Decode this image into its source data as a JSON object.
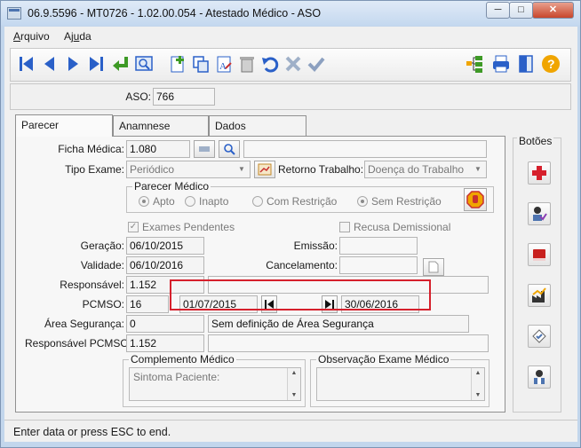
{
  "window": {
    "title": "06.9.5596 - MT0726 - 1.02.00.054 - Atestado Médico - ASO",
    "min_glyph": "─",
    "max_glyph": "□",
    "close_glyph": "✕"
  },
  "menu": [
    {
      "accel": "A",
      "rest": "rquivo"
    },
    {
      "pre": "Aj",
      "accel": "u",
      "rest": "da"
    }
  ],
  "toolbar_icons": [
    "first-record-icon",
    "previous-record-icon",
    "next-record-icon",
    "last-record-icon",
    "return-icon",
    "zoom-icon",
    "new-record-icon",
    "copy-icon",
    "edit-icon",
    "delete-icon",
    "undo-icon",
    "cancel-icon",
    "confirm-icon",
    "hierarchy-icon",
    "print-icon",
    "exit-icon",
    "help-icon"
  ],
  "aso": {
    "label": "ASO:",
    "value": "766"
  },
  "tabs": [
    "Parecer",
    "Anamnese",
    "Dados"
  ],
  "form": {
    "ficha_medica_label": "Ficha Médica:",
    "ficha_medica_value": "1.080",
    "tipo_exame_label": "Tipo Exame:",
    "tipo_exame_value": "Periódico",
    "retorno_label": "Retorno Trabalho:",
    "retorno_value": "Doença do Trabalho",
    "parecer_group_title": "Parecer Médico",
    "parecer_options": [
      "Apto",
      "Inapto",
      "Com Restrição",
      "Sem Restrição"
    ],
    "exames_pendentes": "Exames Pendentes",
    "recusa_demissional": "Recusa Demissional",
    "geracao_label": "Geração:",
    "geracao_value": "06/10/2015",
    "emissao_label": "Emissão:",
    "validade_label": "Validade:",
    "validade_value": "06/10/2016",
    "cancelamento_label": "Cancelamento:",
    "responsavel_label": "Responsável:",
    "responsavel_value": "1.152",
    "pcmso_label": "PCMSO:",
    "pcmso_value": "16",
    "pcmso_start": "01/07/2015",
    "pcmso_end": "30/06/2016",
    "area_label": "Área Segurança:",
    "area_value": "0",
    "area_desc": "Sem definição de Área Segurança",
    "resp_pcmso_label": "Responsável PCMSO:",
    "resp_pcmso_value": "1.152",
    "complemento_title": "Complemento Médico",
    "complemento_value": "Sintoma Paciente:",
    "observacao_title": "Observação Exame Médico"
  },
  "side": {
    "title": "Botões",
    "buttons": [
      "add-red-cross-icon",
      "doctor-check-icon",
      "medical-book-icon",
      "factory-chart-icon",
      "document-check-icon",
      "doctor-icon"
    ]
  },
  "status": "Enter data or press ESC to end.",
  "colors": {
    "accent_blue": "#2a60c8",
    "highlight_red": "#d6202c",
    "green_return": "#3e9a26",
    "help_orange": "#f0a500"
  }
}
